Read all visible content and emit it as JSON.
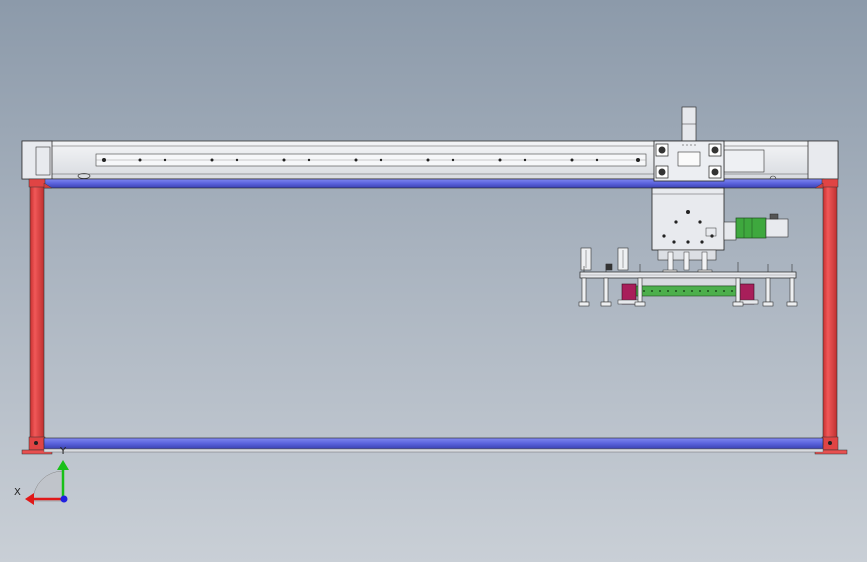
{
  "view": {
    "title": "",
    "background_top": "#8c9aaa",
    "background_bottom": "#c9cfd6"
  },
  "colors": {
    "frame_red": "#e84a4a",
    "beam_blue": "#5f67e0",
    "rail_light": "#eef0f3",
    "motor_green": "#3ea83e",
    "carriage_gray": "#e2e4e8",
    "pad_magenta": "#a81e5a",
    "axis_x": "#e01818",
    "axis_y": "#18c018",
    "axis_z": "#2020e0"
  },
  "triad": {
    "x_label": "X",
    "y_label": "Y",
    "icons": [
      "x-axis-arrow-icon",
      "y-axis-arrow-icon",
      "z-axis-dot-icon"
    ]
  },
  "model": {
    "components": [
      "top-linear-rail",
      "top-blue-beam",
      "left-red-column",
      "right-red-column",
      "bottom-blue-beam",
      "gantry-carriage",
      "servo-motor",
      "gripper-plate",
      "suction-cups"
    ]
  }
}
